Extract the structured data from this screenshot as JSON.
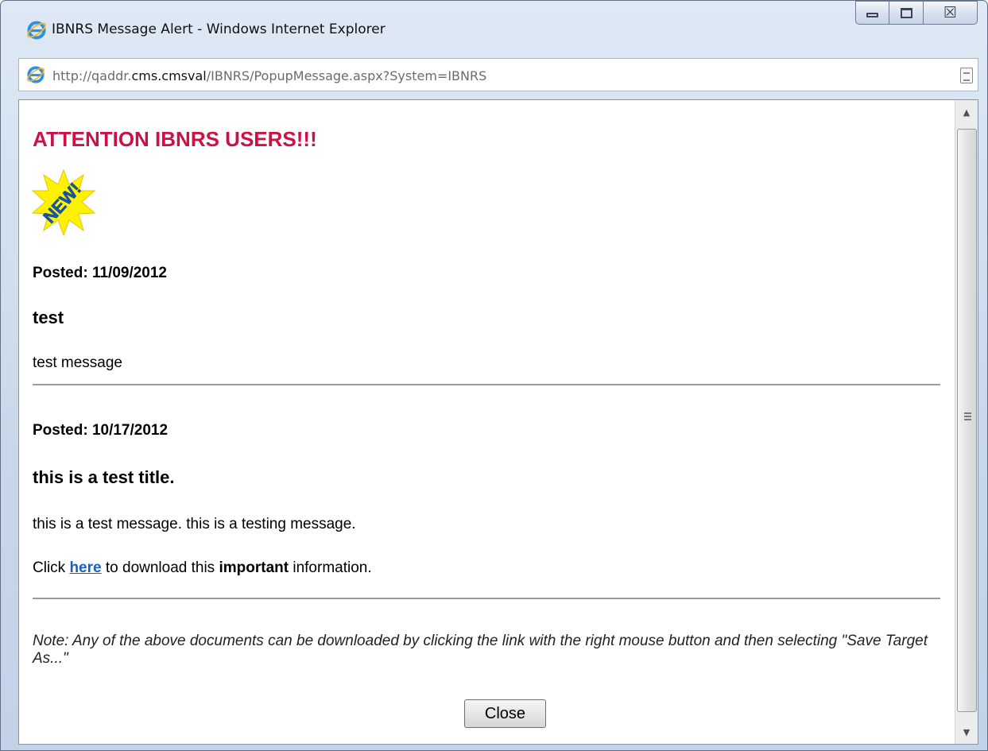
{
  "window": {
    "title": "IBNRS Message Alert - Windows Internet Explorer",
    "url_prefix": "http://qaddr.",
    "url_domain": "cms.cmsval",
    "url_path": "/IBNRS/PopupMessage.aspx?System=IBNRS",
    "icon": "internet-explorer-icon"
  },
  "caption_buttons": {
    "minimize": "minimize-icon",
    "maximize": "restore-icon",
    "close_glyph": "☒",
    "close": "close-icon"
  },
  "page": {
    "heading": "ATTENTION IBNRS USERS!!!",
    "badge_text": "NEW!",
    "messages": [
      {
        "posted": "Posted: 11/09/2012",
        "title": "test",
        "body": "test message"
      },
      {
        "posted": "Posted: 10/17/2012",
        "title": "this is a test title.",
        "body": "this is a test message. this is a testing message.",
        "download_prefix": "Click ",
        "download_link": "here",
        "download_middle": " to download this ",
        "download_bold": "important",
        "download_suffix": " information."
      }
    ],
    "note": "Note: Any of the above documents can be downloaded by clicking the link with the right mouse button and then selecting \"Save Target As...\"",
    "close_label": "Close"
  },
  "colors": {
    "heading": "#cc1144",
    "link": "#1a5fc4"
  }
}
